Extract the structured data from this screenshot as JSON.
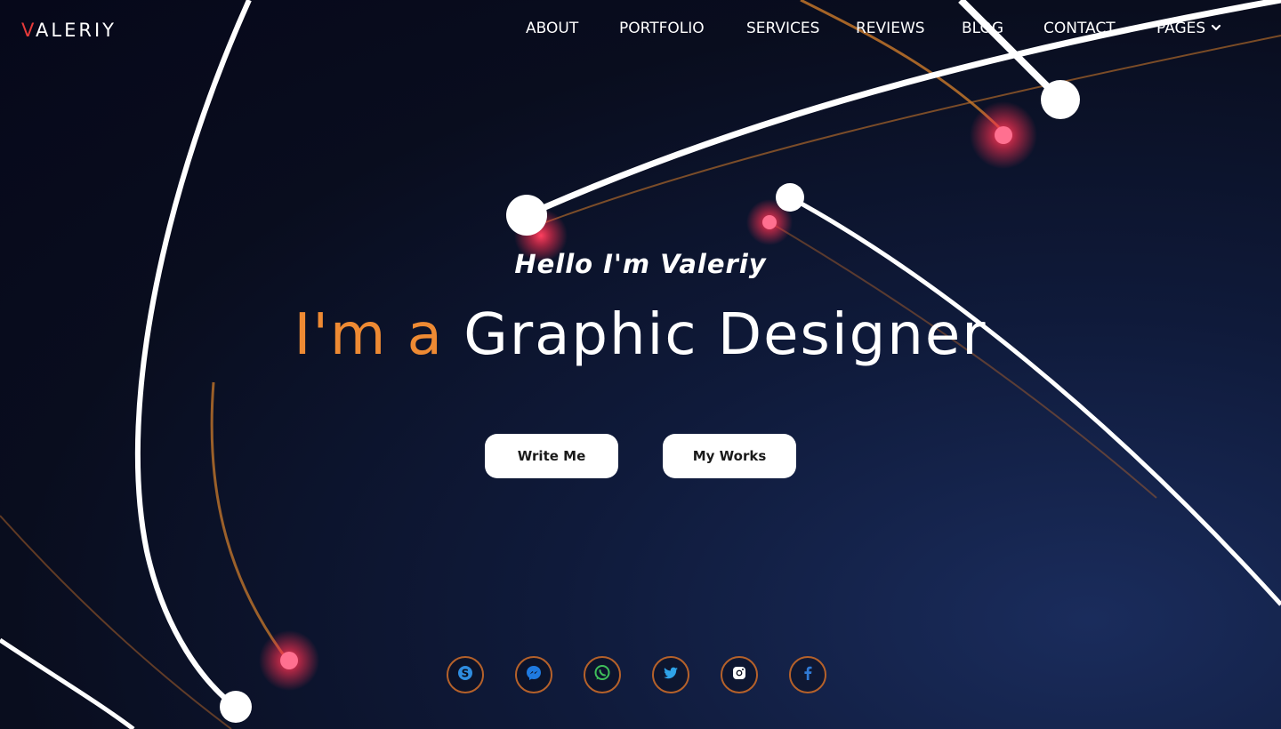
{
  "logo": {
    "first_letter": "V",
    "rest": "ALERIY"
  },
  "nav": {
    "items": [
      {
        "label": "ABOUT"
      },
      {
        "label": "PORTFOLIO"
      },
      {
        "label": "SERVICES"
      },
      {
        "label": "REVIEWS"
      },
      {
        "label": "BLOG"
      },
      {
        "label": "CONTACT"
      },
      {
        "label": "PAGES",
        "has_dropdown": true
      }
    ]
  },
  "hero": {
    "greeting": "Hello I'm Valeriy",
    "headline_accent": "I'm a",
    "headline_main": "Graphic Designer",
    "buttons": {
      "write_me": "Write Me",
      "my_works": "My Works"
    }
  },
  "social": [
    {
      "icon": "skype-icon"
    },
    {
      "icon": "messenger-icon"
    },
    {
      "icon": "whatsapp-icon"
    },
    {
      "icon": "twitter-icon"
    },
    {
      "icon": "instagram-icon"
    },
    {
      "icon": "facebook-icon"
    }
  ],
  "colors": {
    "accent": "#ee8a33",
    "logo_accent": "#e63a3a",
    "background": "#090d1e",
    "social_border": "#b5612a"
  }
}
